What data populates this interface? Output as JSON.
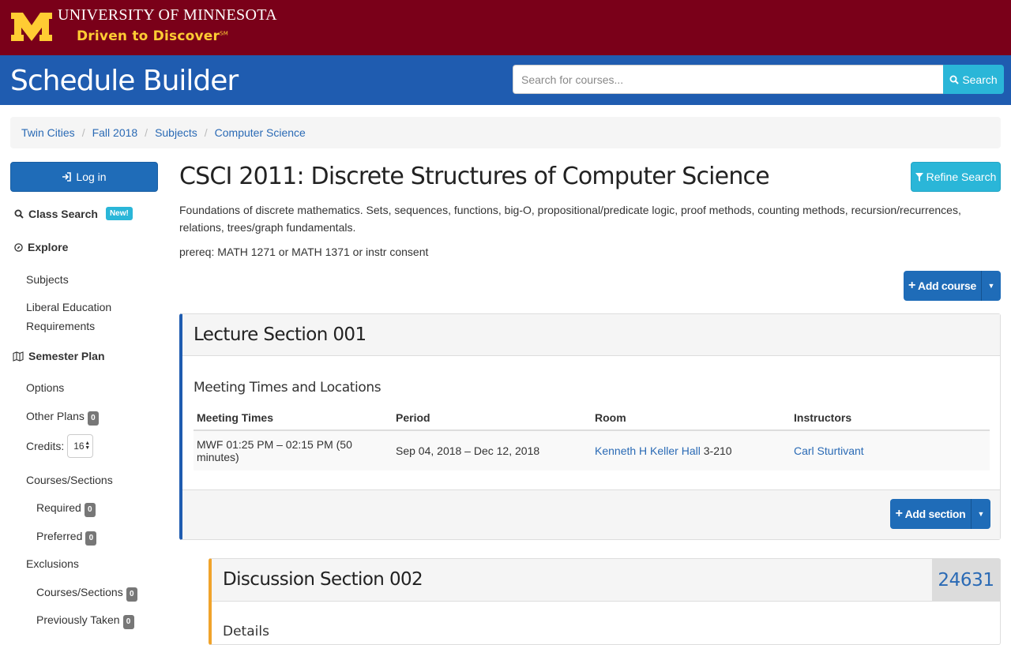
{
  "university": {
    "name": "UNIVERSITY OF MINNESOTA",
    "tagline": "Driven to Discover",
    "tagline_mark": "SM"
  },
  "app": {
    "title": "Schedule Builder",
    "search_placeholder": "Search for courses...",
    "search_label": "Search"
  },
  "breadcrumb": [
    "Twin Cities",
    "Fall 2018",
    "Subjects",
    "Computer Science"
  ],
  "sidebar": {
    "login_label": "Log in",
    "class_search": "Class Search",
    "new_badge": "New!",
    "explore": "Explore",
    "subjects": "Subjects",
    "liberal_ed_line1": "Liberal Education",
    "liberal_ed_line2": "Requirements",
    "semester_plan": "Semester Plan",
    "options": "Options",
    "other_plans": "Other Plans",
    "other_plans_count": "0",
    "credits_label": "Credits:",
    "credits_value": "16",
    "courses_sections": "Courses/Sections",
    "required": "Required",
    "required_count": "0",
    "preferred": "Preferred",
    "preferred_count": "0",
    "exclusions": "Exclusions",
    "excl_courses_sections": "Courses/Sections",
    "excl_courses_sections_count": "0",
    "previously_taken": "Previously Taken",
    "previously_taken_count": "0"
  },
  "course": {
    "title": "CSCI 2011: Discrete Structures of Computer Science",
    "refine_label": "Refine Search",
    "description": "Foundations of discrete mathematics. Sets, sequences, functions, big-O, propositional/predicate logic, proof methods, counting methods, recursion/recurrences, relations, trees/graph fundamentals.",
    "prereq": "prereq: MATH 1271 or MATH 1371 or instr consent",
    "add_course_label": "Add course"
  },
  "lecture": {
    "title": "Lecture Section 001",
    "meeting_heading": "Meeting Times and Locations",
    "columns": [
      "Meeting Times",
      "Period",
      "Room",
      "Instructors"
    ],
    "row": {
      "times": "MWF 01:25 PM – 02:15 PM (50 minutes)",
      "period": "Sep 04, 2018 – Dec 12, 2018",
      "building": "Kenneth H Keller Hall",
      "room": "3-210",
      "instructor": "Carl Sturtivant"
    },
    "add_section_label": "Add section"
  },
  "discussion": {
    "title": "Discussion Section 002",
    "number": "24631",
    "details_heading": "Details"
  },
  "colors": {
    "maroon": "#7a0019",
    "gold": "#ffcc33",
    "app_blue": "#1f5cb0",
    "button_blue": "#1f6cb8",
    "info_cyan": "#2ab6d8",
    "link_blue": "#2a6ab5",
    "discussion_orange": "#f0a32b"
  },
  "icons": {
    "search": "search-icon",
    "login": "sign-in-icon",
    "explore": "compass-icon",
    "semester_plan": "map-icon",
    "refine": "filter-icon",
    "add": "plus-icon",
    "dropdown": "caret-down-icon"
  }
}
